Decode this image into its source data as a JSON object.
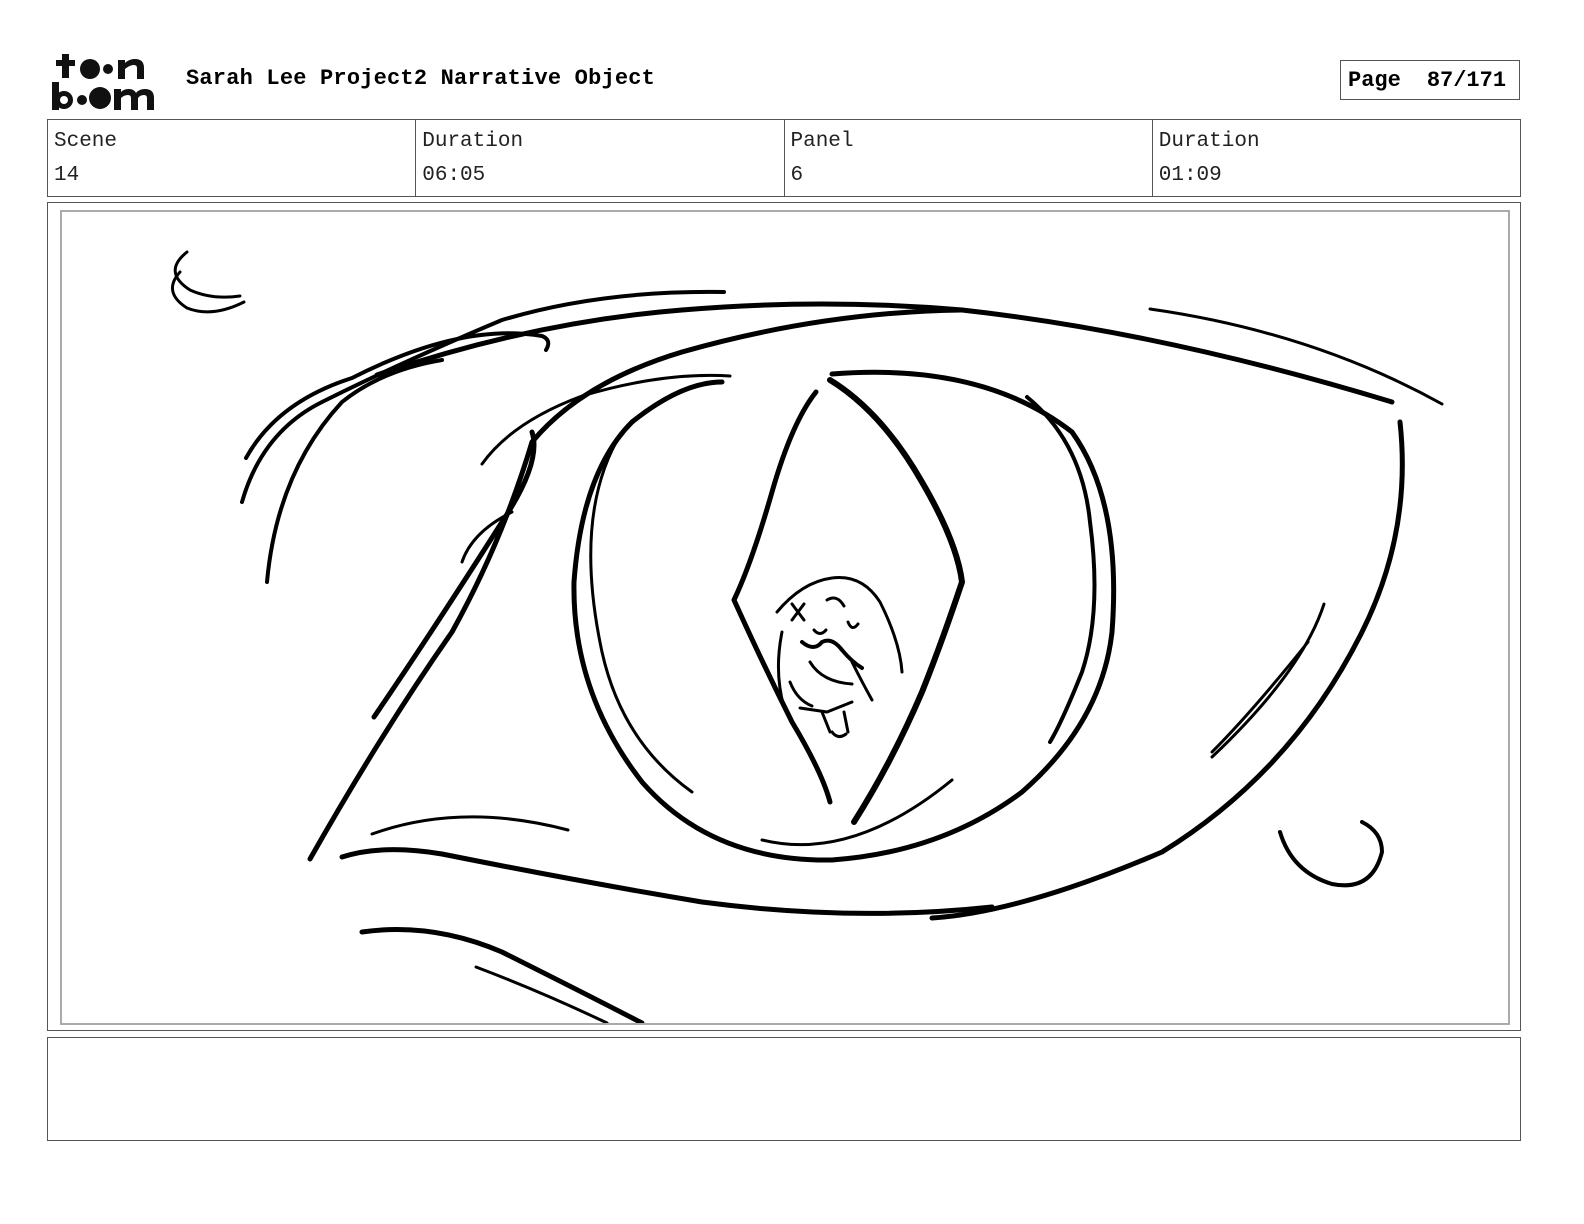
{
  "header": {
    "logo_text_top": "t••n",
    "logo_text_bottom": "b••m",
    "project_title": "Sarah Lee Project2 Narrative Object",
    "page_label": "Page",
    "page_number": "87/171"
  },
  "info": {
    "scene_label": "Scene",
    "scene_value": "14",
    "scene_duration_label": "Duration",
    "scene_duration_value": "06:05",
    "panel_label": "Panel",
    "panel_value": "6",
    "panel_duration_label": "Duration",
    "panel_duration_value": "01:09"
  },
  "panel": {
    "drawing": "storyboard sketch: close-up of an eye with a figure reflected in the slit pupil"
  },
  "notes": {
    "text": ""
  }
}
